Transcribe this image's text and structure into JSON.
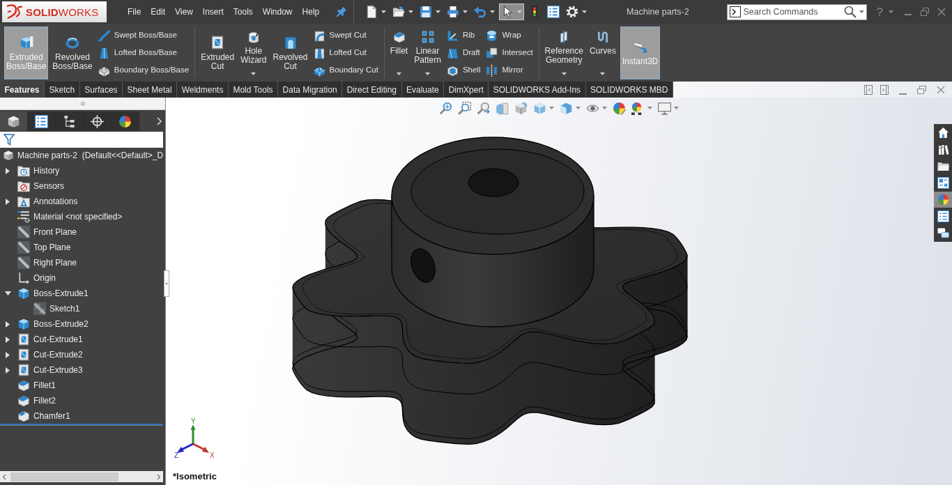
{
  "app": {
    "logo": "**SOLID**WORKS"
  },
  "menu": [
    "File",
    "Edit",
    "View",
    "Insert",
    "Tools",
    "Window",
    "Help"
  ],
  "quick_access": [
    {
      "kind": "new",
      "dropdown": true,
      "selected": false
    },
    {
      "kind": "open",
      "dropdown": true,
      "selected": false
    },
    {
      "kind": "save",
      "dropdown": true,
      "selected": false
    },
    {
      "kind": "print",
      "dropdown": true,
      "selected": false
    },
    {
      "kind": "undo",
      "dropdown": true,
      "selected": false
    },
    {
      "kind": "select",
      "dropdown": true,
      "selected": true
    },
    {
      "kind": "rebuild",
      "dropdown": false,
      "selected": false
    },
    {
      "kind": "properties",
      "dropdown": false,
      "selected": false
    },
    {
      "kind": "options",
      "dropdown": true,
      "selected": false
    }
  ],
  "window": {
    "title": "Machine parts-2"
  },
  "search": {
    "placeholder": "Search Commands"
  },
  "help": "?",
  "ribbon": [
    {
      "large": [
        {
          "kind": "extrude",
          "label": "Extruded Boss/Base",
          "selected": true,
          "dropdown": false
        },
        {
          "kind": "revolve",
          "label": "Revolved Boss/Base",
          "selected": false,
          "dropdown": false
        }
      ],
      "columns": [
        [
          {
            "kind": "swept",
            "label": "Swept Boss/Base"
          },
          {
            "kind": "loft",
            "label": "Lofted Boss/Base"
          },
          {
            "kind": "boundary",
            "label": "Boundary Boss/Base"
          }
        ]
      ]
    },
    {
      "large": [
        {
          "kind": "cutextrude",
          "label": "Extruded Cut",
          "selected": false,
          "dropdown": false
        },
        {
          "kind": "hole",
          "label": "Hole Wizard",
          "selected": false,
          "dropdown": true
        },
        {
          "kind": "revolvecut",
          "label": "Revolved Cut",
          "selected": false,
          "dropdown": false
        }
      ],
      "columns": [
        [
          {
            "kind": "sweptcut",
            "label": "Swept Cut"
          },
          {
            "kind": "loftcut",
            "label": "Lofted Cut"
          },
          {
            "kind": "boundarycut",
            "label": "Boundary Cut"
          }
        ]
      ]
    },
    {
      "large": [
        {
          "kind": "fillet",
          "label": "Fillet",
          "selected": false,
          "dropdown": true
        },
        {
          "kind": "pattern",
          "label": "Linear Pattern",
          "selected": false,
          "dropdown": true
        }
      ],
      "columns": [
        [
          {
            "kind": "rib",
            "label": "Rib"
          },
          {
            "kind": "draft",
            "label": "Draft"
          },
          {
            "kind": "shell",
            "label": "Shell"
          }
        ],
        [
          {
            "kind": "wrap",
            "label": "Wrap"
          },
          {
            "kind": "intersect",
            "label": "Intersect"
          },
          {
            "kind": "mirror",
            "label": "Mirror"
          }
        ]
      ]
    },
    {
      "large": [
        {
          "kind": "refgeom",
          "label": "Reference Geometry",
          "selected": false,
          "dropdown": true
        },
        {
          "kind": "curves",
          "label": "Curves",
          "selected": false,
          "dropdown": true
        },
        {
          "kind": "instant3d",
          "label": "Instant3D",
          "selected": true,
          "dropdown": false
        }
      ]
    }
  ],
  "command_tabs": [
    {
      "label": "Features",
      "selected": true
    },
    {
      "label": "Sketch",
      "selected": false
    },
    {
      "label": "Surfaces",
      "selected": false
    },
    {
      "label": "Sheet Metal",
      "selected": false
    },
    {
      "label": "Weldments",
      "selected": false
    },
    {
      "label": "Mold Tools",
      "selected": false
    },
    {
      "label": "Data Migration",
      "selected": false
    },
    {
      "label": "Direct Editing",
      "selected": false
    },
    {
      "label": "Evaluate",
      "selected": false
    },
    {
      "label": "DimXpert",
      "selected": false
    },
    {
      "label": "SOLIDWORKS Add-Ins",
      "selected": false
    },
    {
      "label": "SOLIDWORKS MBD",
      "selected": false
    }
  ],
  "feature_manager": {
    "tabs": [
      {
        "kind": "feature",
        "selected": true
      },
      {
        "kind": "property",
        "selected": false
      },
      {
        "kind": "config",
        "selected": false
      },
      {
        "kind": "dimxpert",
        "selected": false
      },
      {
        "kind": "display",
        "selected": false
      }
    ],
    "root": "Machine parts-2  (Default<<Default>_D",
    "tree": [
      {
        "kind": "history",
        "label": "History",
        "expanded": false
      },
      {
        "kind": "sensors",
        "label": "Sensors"
      },
      {
        "kind": "annotations",
        "label": "Annotations",
        "expanded": false
      },
      {
        "kind": "material",
        "label": "Material <not specified>"
      },
      {
        "kind": "plane",
        "label": "Front Plane"
      },
      {
        "kind": "plane",
        "label": "Top Plane"
      },
      {
        "kind": "plane",
        "label": "Right Plane"
      },
      {
        "kind": "origin",
        "label": "Origin"
      },
      {
        "kind": "boss",
        "label": "Boss-Extrude1",
        "expanded": true,
        "children": [
          {
            "kind": "sketch",
            "label": "Sketch1"
          }
        ]
      },
      {
        "kind": "boss",
        "label": "Boss-Extrude2",
        "expanded": false
      },
      {
        "kind": "cut",
        "label": "Cut-Extrude1",
        "expanded": false
      },
      {
        "kind": "cut",
        "label": "Cut-Extrude2",
        "expanded": false
      },
      {
        "kind": "cut",
        "label": "Cut-Extrude3",
        "expanded": false
      },
      {
        "kind": "fillet",
        "label": "Fillet1"
      },
      {
        "kind": "fillet",
        "label": "Fillet2"
      },
      {
        "kind": "chamfer",
        "label": "Chamfer1"
      }
    ]
  },
  "viewport": {
    "heads_up": [
      {
        "kind": "zoomfit",
        "dropdown": false
      },
      {
        "kind": "zoomarea",
        "dropdown": false
      },
      {
        "kind": "prevview",
        "dropdown": false
      },
      {
        "kind": "section",
        "dropdown": false
      },
      {
        "kind": "annotation",
        "dropdown": false
      },
      {
        "kind": "orientation",
        "dropdown": true
      },
      {
        "kind": "displaystyle",
        "dropdown": true
      },
      {
        "kind": "hideshow",
        "dropdown": true
      },
      {
        "kind": "appearance",
        "dropdown": false
      },
      {
        "kind": "scene",
        "dropdown": true
      },
      {
        "kind": "viewsettings",
        "dropdown": true
      }
    ],
    "task_pane": [
      {
        "kind": "home",
        "selected": false
      },
      {
        "kind": "library",
        "selected": false
      },
      {
        "kind": "explorer",
        "selected": false
      },
      {
        "kind": "palette",
        "selected": false
      },
      {
        "kind": "appearances",
        "selected": true
      },
      {
        "kind": "properties",
        "selected": false
      },
      {
        "kind": "forum",
        "selected": false
      }
    ],
    "triad": {
      "x": "X",
      "y": "Y",
      "z": "Z"
    },
    "view_name": "*Isometric"
  }
}
